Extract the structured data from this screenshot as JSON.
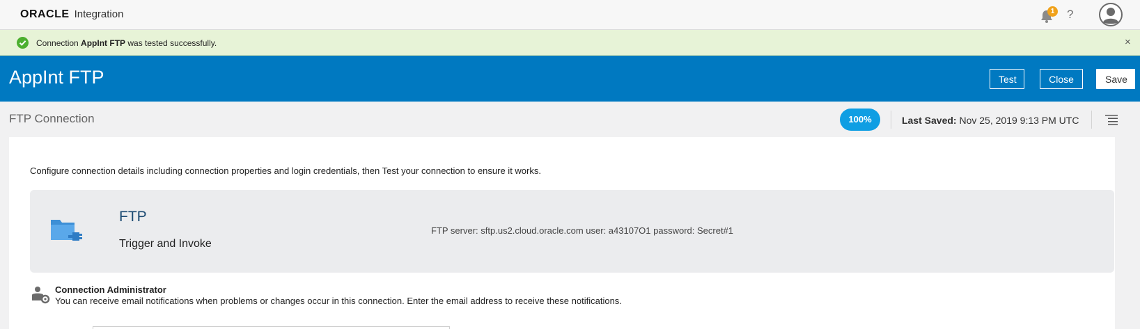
{
  "header": {
    "brand_logo": "ORACLE",
    "brand_product": "Integration",
    "notification_count": "1",
    "help_label": "?"
  },
  "banner": {
    "prefix": "Connection ",
    "connection_name": "AppInt FTP",
    "suffix": " was tested successfully.",
    "close_label": "×"
  },
  "titlebar": {
    "title": "AppInt FTP",
    "test_label": "Test",
    "close_label": "Close",
    "save_label": "Save"
  },
  "subbar": {
    "subtitle": "FTP Connection",
    "percent": "100%",
    "last_saved_label": "Last Saved:",
    "last_saved_value": " Nov 25, 2019 9:13 PM UTC"
  },
  "main": {
    "intro": "Configure connection details including connection properties and login credentials, then Test your connection to ensure it works.",
    "card": {
      "name": "FTP",
      "role": "Trigger and Invoke",
      "description": "FTP server: sftp.us2.cloud.oracle.com user: a43107O1 password: Secret#1"
    },
    "admin": {
      "title": "Connection Administrator",
      "description": "You can receive email notifications when problems or changes occur in this connection. Enter the email address to receive these notifications."
    }
  },
  "colors": {
    "title_bar": "#0079c1",
    "banner": "#e7f3d7",
    "success": "#4caf2f",
    "badge": "#f0a21b",
    "progress": "#0f9ee3"
  }
}
